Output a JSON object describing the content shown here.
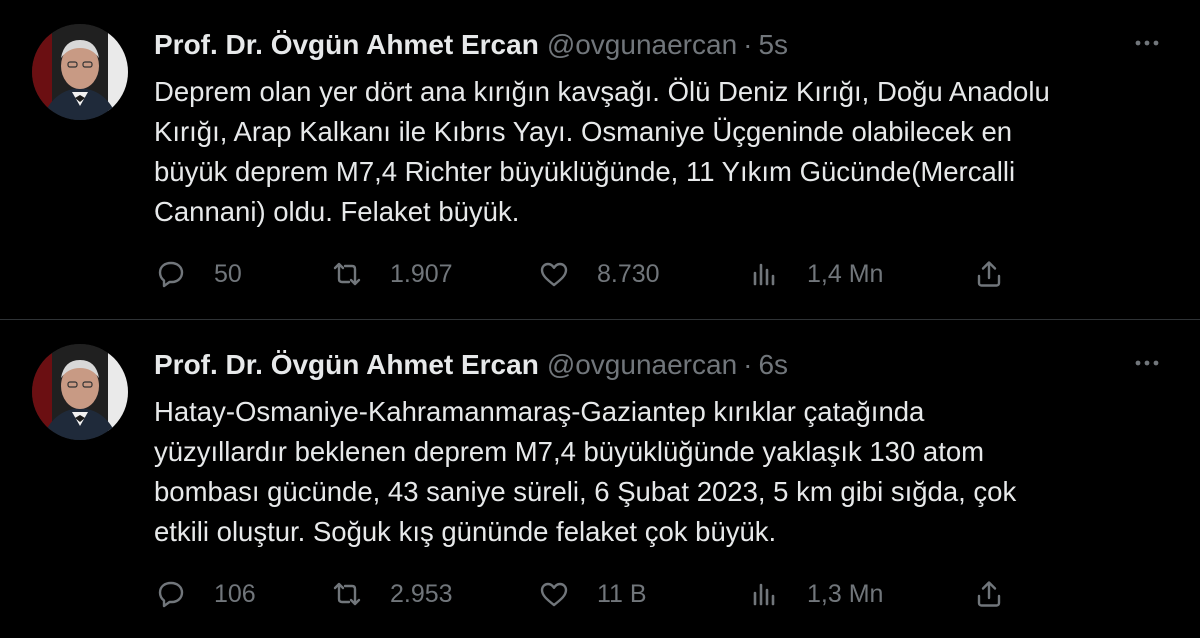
{
  "tweets": [
    {
      "author_name": "Prof. Dr. Övgün Ahmet Ercan",
      "handle": "@ovgunaercan",
      "separator": "·",
      "time": "5s",
      "text": "Deprem olan yer dört ana kırığın kavşağı. Ölü Deniz Kırığı, Doğu Anadolu\nKırığı, Arap Kalkanı ile Kıbrıs Yayı. Osmaniye Üçgeninde olabilecek en\nbüyük deprem M7,4 Richter büyüklüğünde, 11 Yıkım Gücünde(Mercalli\nCannani) oldu. Felaket büyük.",
      "replies": "50",
      "retweets": "1.907",
      "likes": "8.730",
      "views": "1,4 Mn"
    },
    {
      "author_name": "Prof. Dr. Övgün Ahmet Ercan",
      "handle": "@ovgunaercan",
      "separator": "·",
      "time": "6s",
      "text": "Hatay-Osmaniye-Kahramanmaraş-Gaziantep kırıklar çatağında\nyüzyıllardır beklenen deprem M7,4 büyüklüğünde yaklaşık 130 atom\nbombası gücünde, 43 saniye süreli, 6 Şubat 2023, 5 km gibi sığda, çok\netkili oluştur. Soğuk kış gününde felaket çok büyük.",
      "replies": "106",
      "retweets": "2.953",
      "likes": "11 B",
      "views": "1,3 Mn"
    }
  ],
  "icons": {
    "reply": "reply-icon",
    "retweet": "retweet-icon",
    "like": "like-icon",
    "views": "views-icon",
    "share": "share-icon",
    "more": "more-icon"
  },
  "colors": {
    "background": "#000000",
    "text_primary": "#e7e9ea",
    "text_secondary": "#71767b",
    "divider": "#2f3336"
  }
}
